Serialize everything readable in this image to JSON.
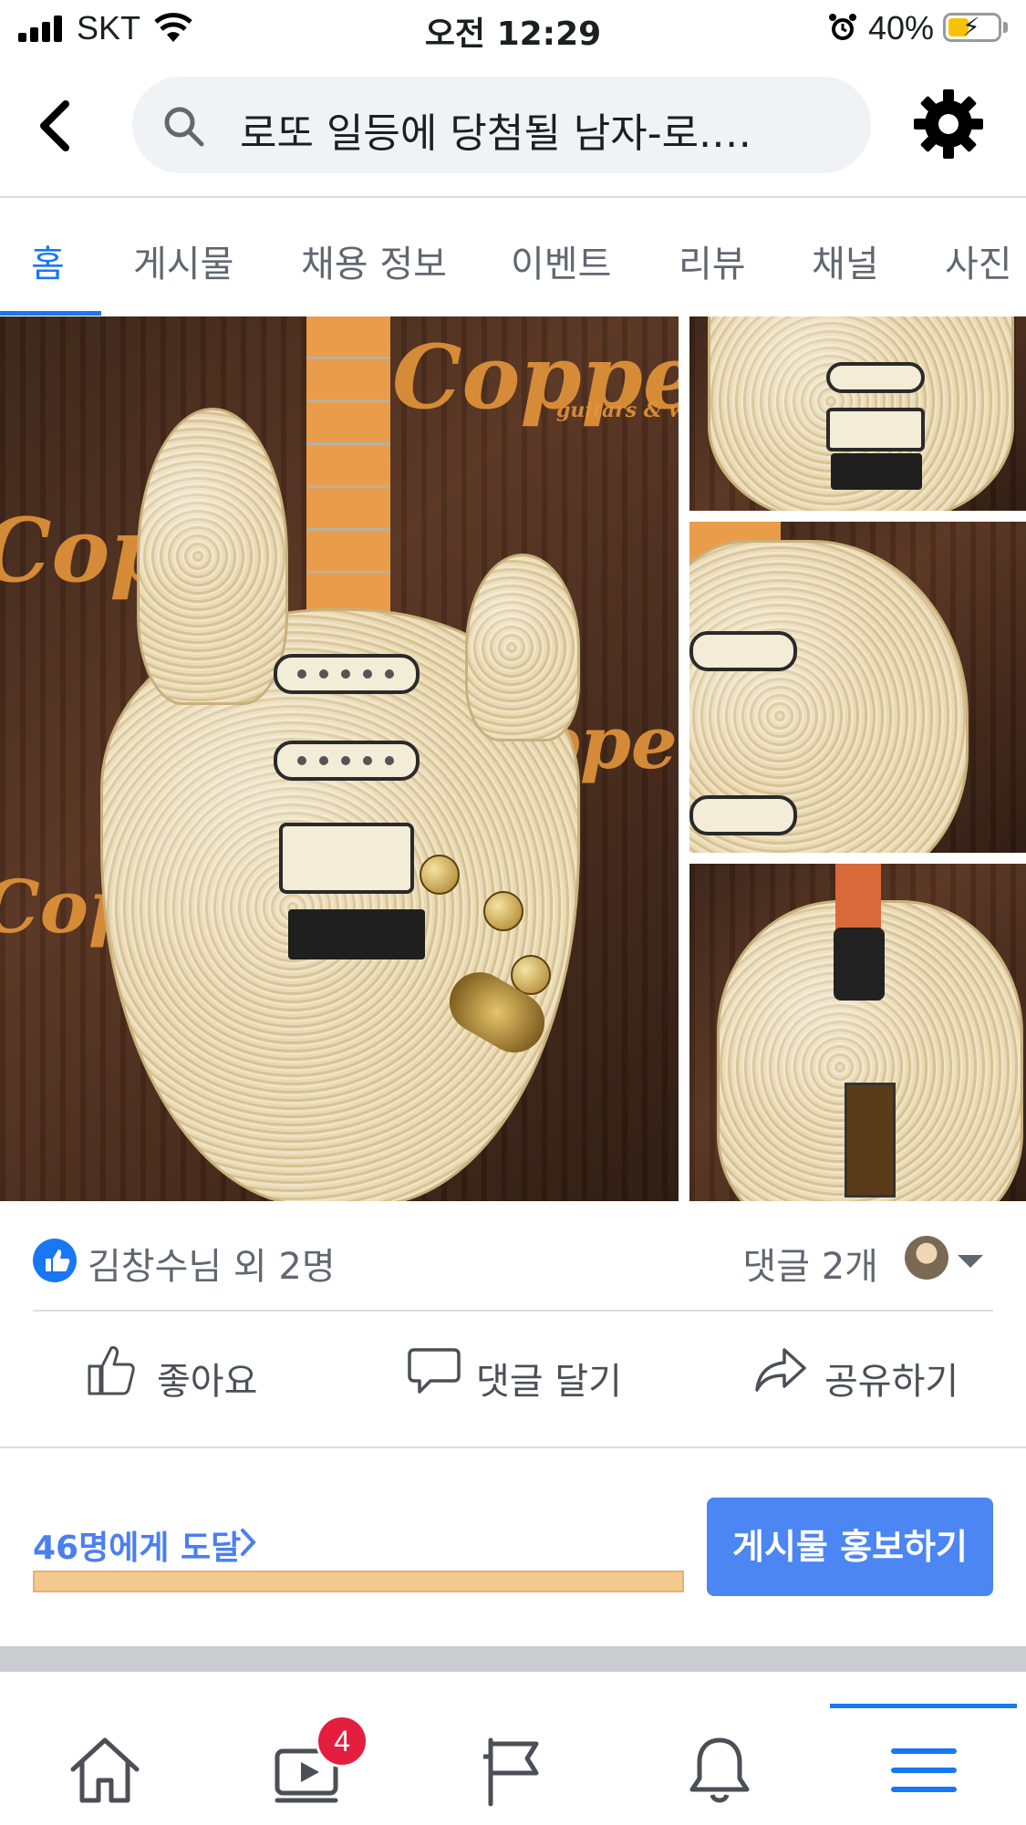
{
  "status_bar": {
    "carrier": "SKT",
    "time": "오전 12:29",
    "battery": "40%",
    "battery_level": 0.4
  },
  "header": {
    "search_query": "로또 일등에 당첨될 남자-로.…",
    "icons": [
      "back-arrow-icon",
      "search-icon",
      "gear-icon"
    ]
  },
  "tabs": [
    {
      "label": "홈",
      "active": true
    },
    {
      "label": "게시물",
      "active": false
    },
    {
      "label": "채용 정보",
      "active": false
    },
    {
      "label": "이벤트",
      "active": false
    },
    {
      "label": "리뷰",
      "active": false
    },
    {
      "label": "채널",
      "active": false
    },
    {
      "label": "사진",
      "active": false
    }
  ],
  "photos": {
    "brand_text_main": "Copper",
    "brand_text_sub": "guitars & w",
    "brand_text_small": "guitars & woo",
    "brand_text_partial": "Copp",
    "brand_text_partial2": "pper",
    "brand_text_partial3": "Cop"
  },
  "reactions": {
    "names": "김창수님 외 2명",
    "comments": "댓글 2개"
  },
  "actions": {
    "like": "좋아요",
    "comment": "댓글 달기",
    "share": "공유하기"
  },
  "reach": {
    "text": "46명에게 도달",
    "boost_button": "게시물 홍보하기"
  },
  "bottom_nav": {
    "items": [
      "home-icon",
      "video-icon",
      "flag-icon",
      "bell-icon",
      "menu-icon"
    ],
    "video_badge": "4",
    "active_index": 4
  },
  "colors": {
    "accent": "#1877f2",
    "boost": "#4b86f2",
    "reach_bar": "#f4c98e",
    "badge": "#e41e3f"
  }
}
